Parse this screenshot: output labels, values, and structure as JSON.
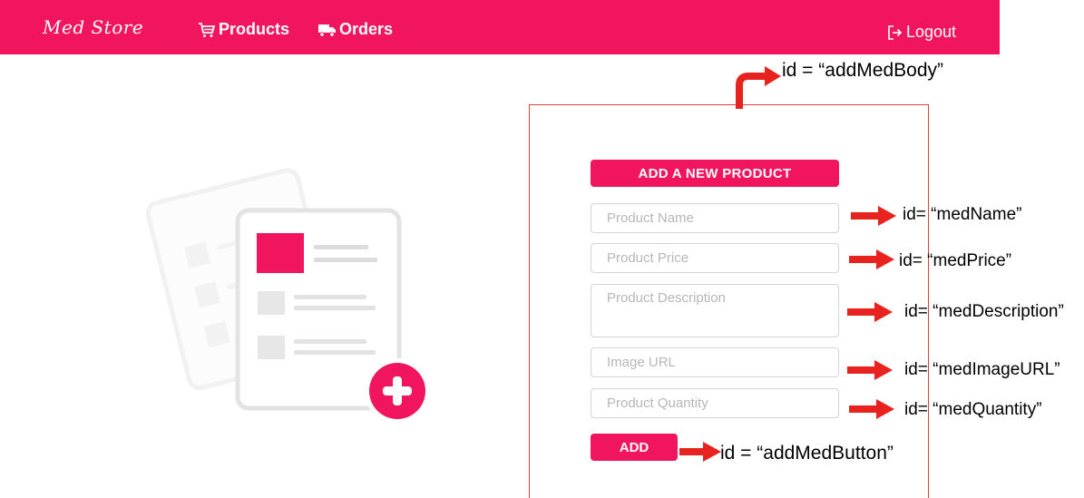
{
  "navbar": {
    "brand": "Med Store",
    "products_label": "Products",
    "orders_label": "Orders",
    "logout_label": "Logout",
    "color": "#f0155e"
  },
  "form": {
    "title": "ADD A NEW PRODUCT",
    "fields": {
      "name_placeholder": "Product Name",
      "price_placeholder": "Product Price",
      "description_placeholder": "Product Description",
      "image_placeholder": "Image URL",
      "quantity_placeholder": "Product Quantity"
    },
    "add_label": "ADD"
  },
  "annotations": {
    "body": "id = “addMedBody”",
    "name": "id= “medName”",
    "price": "id= “medPrice”",
    "description": "id= “medDescription”",
    "image": "id= “medImageURL”",
    "quantity": "id= “medQuantity”",
    "button": "id = “addMedButton”",
    "arrow_color": "#e8231f"
  },
  "icons": {
    "products": "cart-icon",
    "orders": "truck-icon",
    "logout": "logout-icon",
    "illustration": "document-add-illustration"
  }
}
